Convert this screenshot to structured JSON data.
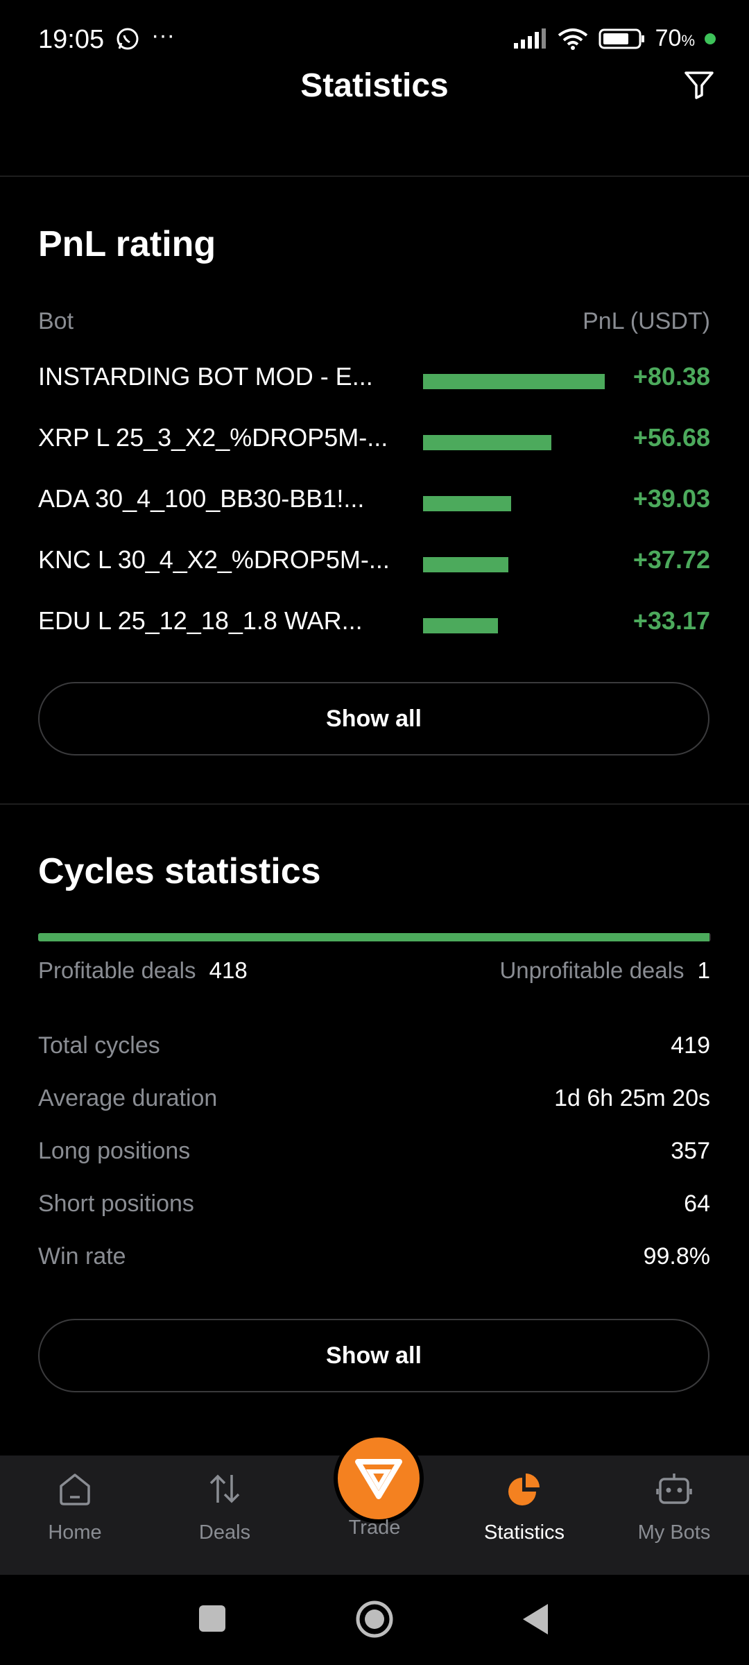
{
  "status_bar": {
    "time": "19:05",
    "battery": "70",
    "battery_unit": "%"
  },
  "header": {
    "title": "Statistics"
  },
  "pnl": {
    "title": "PnL rating",
    "col_bot": "Bot",
    "col_pnl": "PnL (USDT)",
    "rows": [
      {
        "name": "INSTARDING BOT MOD - E...",
        "value": "+80.38",
        "fill": 1.0
      },
      {
        "name": "XRP L 25_3_X2_%DROP5M-...",
        "value": "+56.68",
        "fill": 0.705
      },
      {
        "name": "ADA 30_4_100_BB30-BB1!...",
        "value": "+39.03",
        "fill": 0.486
      },
      {
        "name": "KNC L 30_4_X2_%DROP5M-...",
        "value": "+37.72",
        "fill": 0.469
      },
      {
        "name": "EDU L 25_12_18_1.8 WAR...",
        "value": "+33.17",
        "fill": 0.413
      }
    ],
    "show_all": "Show all"
  },
  "cycles": {
    "title": "Cycles statistics",
    "profitable_label": "Profitable deals",
    "profitable_value": "418",
    "unprofitable_label": "Unprofitable deals",
    "unprofitable_value": "1",
    "profitable_fraction": 0.998,
    "stats": [
      {
        "label": "Total cycles",
        "value": "419"
      },
      {
        "label": "Average duration",
        "value": "1d 6h 25m 20s"
      },
      {
        "label": "Long positions",
        "value": "357"
      },
      {
        "label": "Short positions",
        "value": "64"
      },
      {
        "label": "Win rate",
        "value": "99.8%"
      }
    ],
    "show_all": "Show all"
  },
  "nav": {
    "home": "Home",
    "deals": "Deals",
    "trade": "Trade",
    "statistics": "Statistics",
    "my_bots": "My Bots"
  },
  "colors": {
    "accent_orange": "#f48120",
    "profit_green": "#4caa5c"
  }
}
